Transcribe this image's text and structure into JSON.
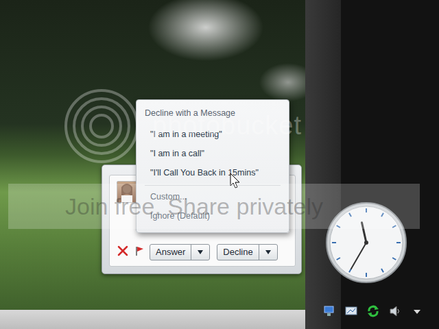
{
  "call_toast": {
    "buttons": [
      {
        "label": "Answer"
      },
      {
        "label": "Decline"
      }
    ]
  },
  "decline_menu": {
    "title": "Decline with a Message",
    "items": [
      {
        "label": "\"I am in a meeting\"",
        "kind": "message"
      },
      {
        "label": "\"I am in a call\"",
        "kind": "message"
      },
      {
        "label": "\"I'll Call You Back in 15mins\"",
        "kind": "message"
      },
      {
        "label": "Custom...",
        "kind": "action"
      },
      {
        "label": "Ignore (Default)",
        "kind": "action"
      }
    ]
  },
  "clock": {
    "hour": 11,
    "minute": 35
  },
  "watermark": {
    "logo": "photobucket",
    "slogan": "Join free. Share privately"
  }
}
